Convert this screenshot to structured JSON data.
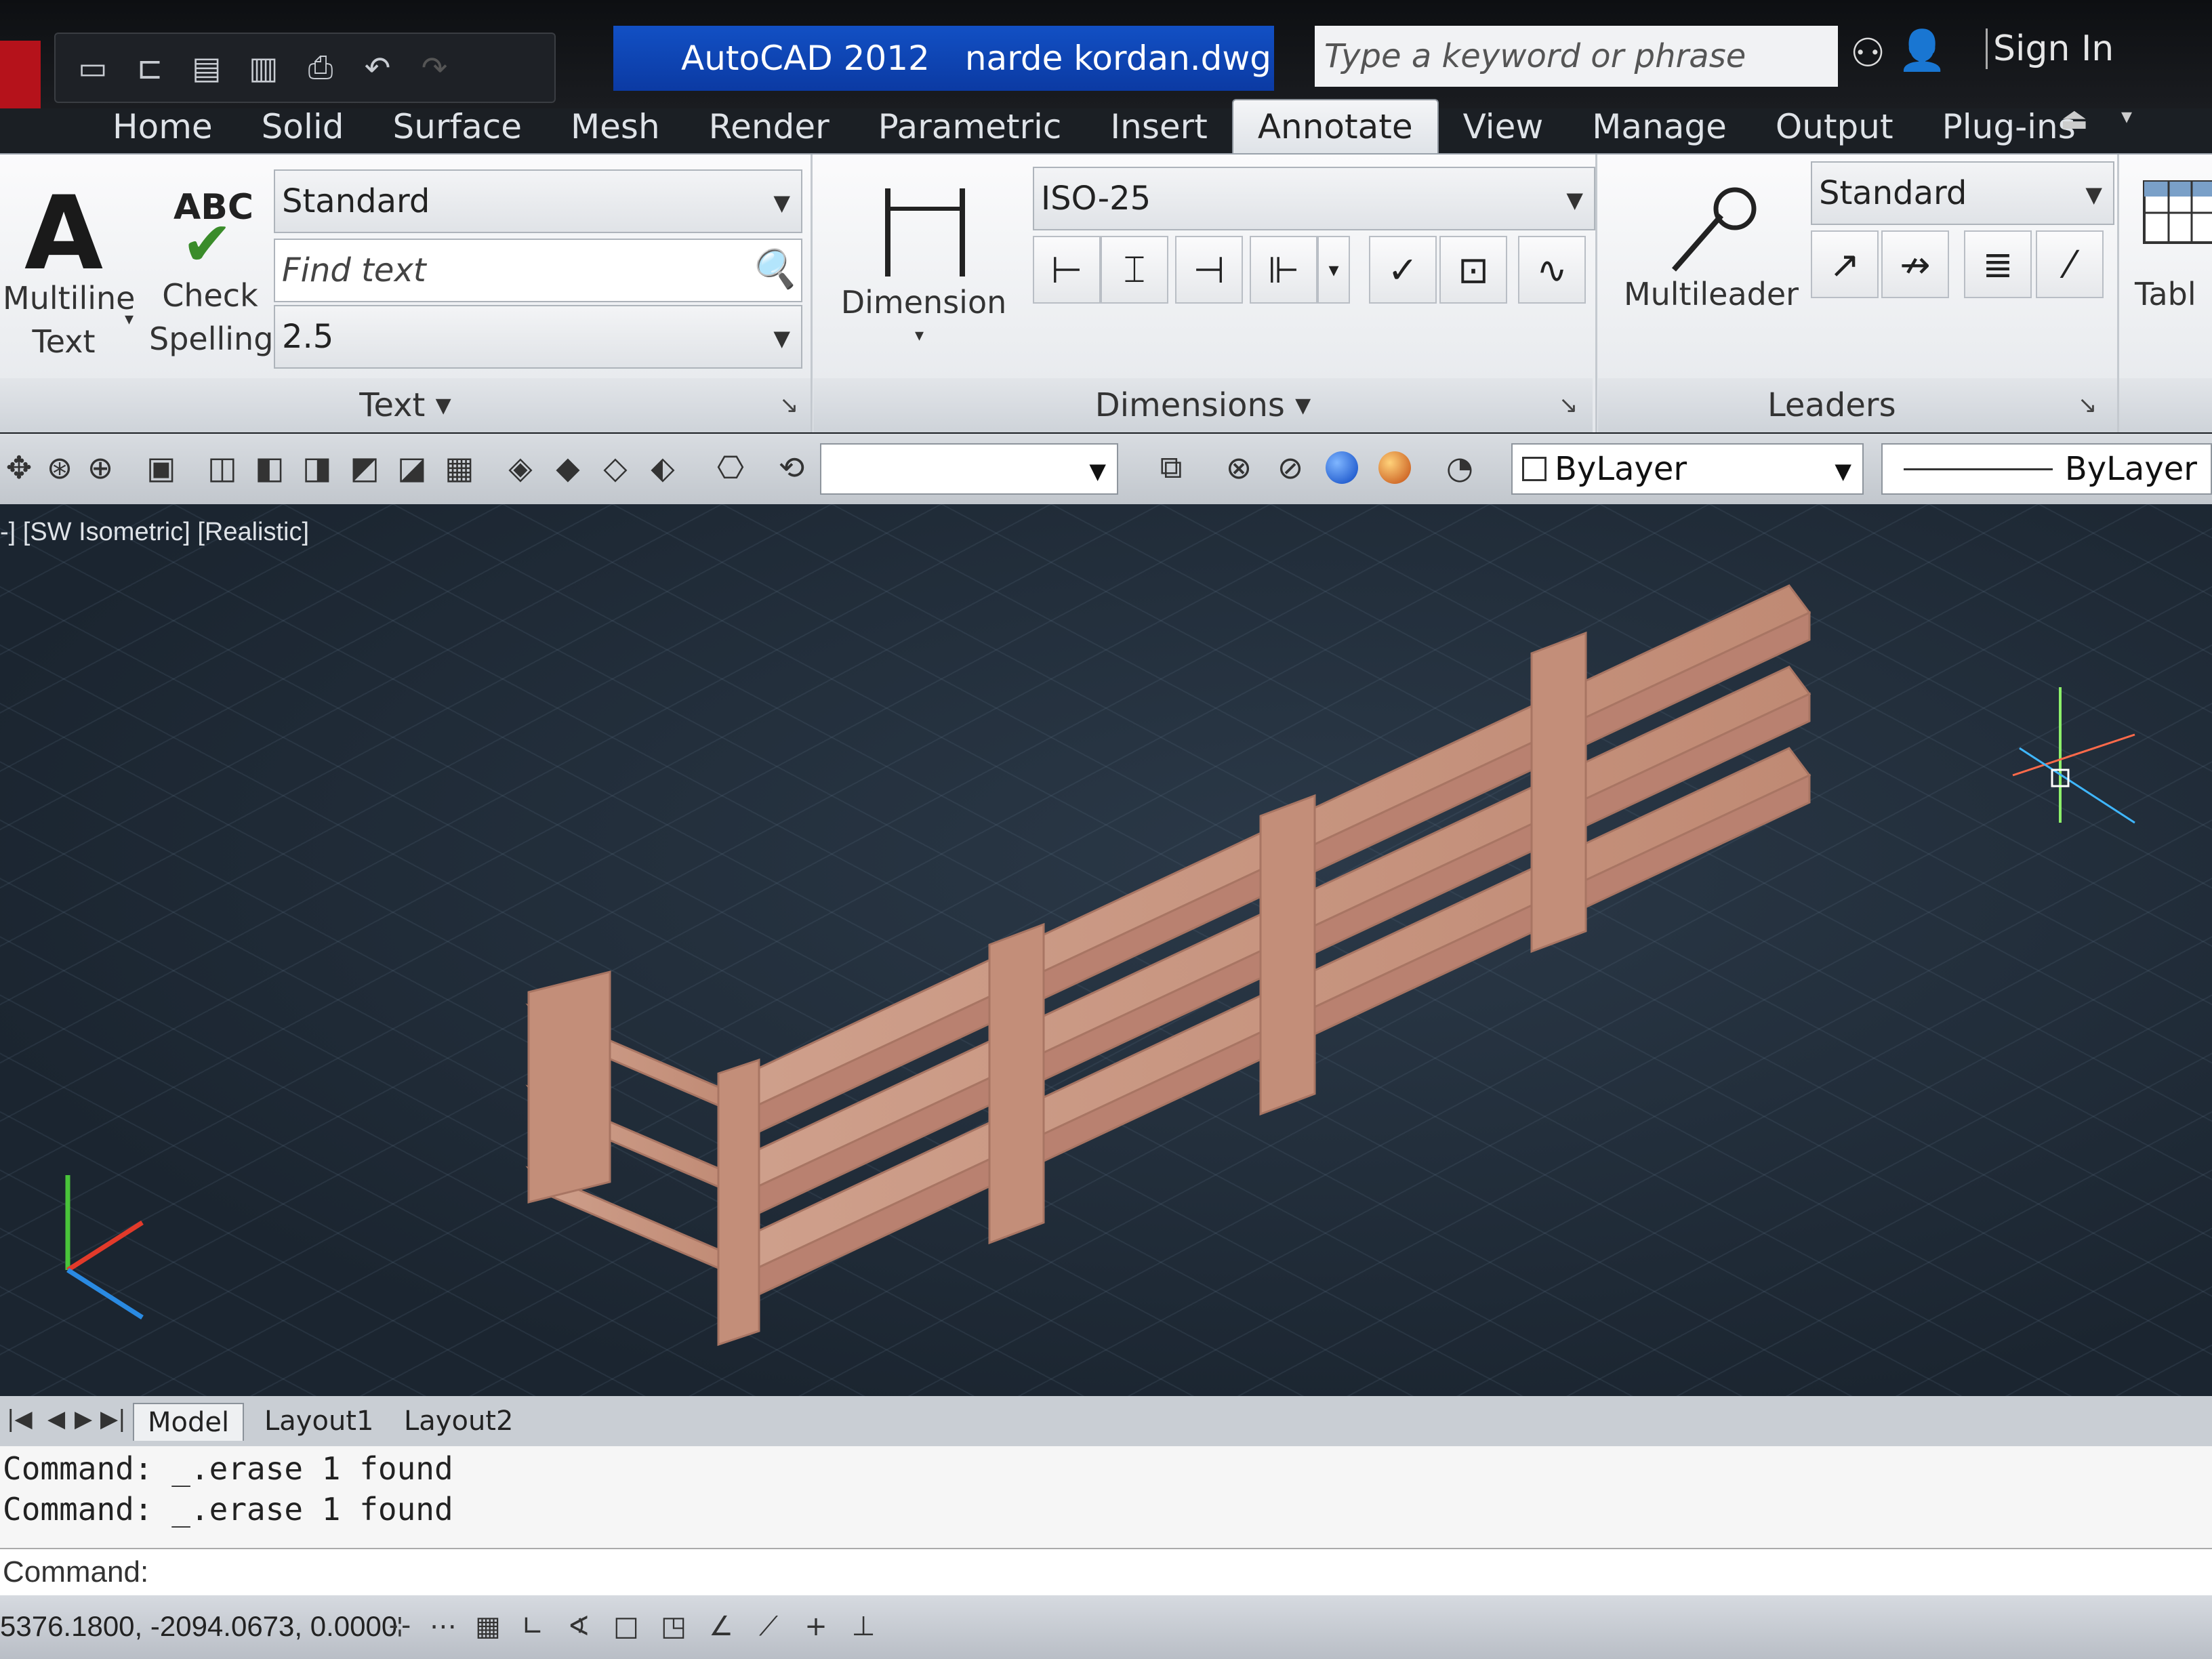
{
  "app": {
    "name": "AutoCAD 2012",
    "document": "narde kordan.dwg"
  },
  "search": {
    "placeholder": "Type a keyword or phrase"
  },
  "account": {
    "sign_in": "Sign In"
  },
  "tabs": [
    "Home",
    "Solid",
    "Surface",
    "Mesh",
    "Render",
    "Parametric",
    "Insert",
    "Annotate",
    "View",
    "Manage",
    "Output",
    "Plug-ins"
  ],
  "active_tab": "Annotate",
  "ribbon": {
    "text_panel": {
      "title": "Text",
      "multiline_text": [
        "Multiline",
        "Text"
      ],
      "check_spelling": [
        "Check",
        "Spelling"
      ],
      "abc_glyph": "ABC",
      "text_style": "Standard",
      "find_text_placeholder": "Find text",
      "text_height": "2.5"
    },
    "dimensions_panel": {
      "title": "Dimensions",
      "dimension_label": "Dimension",
      "dim_style": "ISO-25"
    },
    "leaders_panel": {
      "title": "Leaders",
      "multileader_label": "Multileader",
      "mleader_style": "Standard"
    },
    "table_panel": {
      "label": "Tabl"
    }
  },
  "toolbar": {
    "layer_color": "ByLayer",
    "linetype": "ByLayer"
  },
  "viewport": {
    "label": "-] [SW Isometric] [Realistic]",
    "wood_color": "#c9957f",
    "grid_color": "#5a6e82"
  },
  "layout_tabs": [
    "Model",
    "Layout1",
    "Layout2"
  ],
  "command": {
    "history": [
      "Command: _.erase 1 found",
      "Command: _.erase 1 found"
    ],
    "prompt": "Command:"
  },
  "status": {
    "coordinates": "5376.1800, -2094.0673, 0.0000"
  },
  "icons": {
    "qat": [
      "new-icon",
      "open-icon",
      "save-icon",
      "save-as-icon",
      "plot-icon",
      "undo-icon",
      "redo-icon"
    ]
  }
}
